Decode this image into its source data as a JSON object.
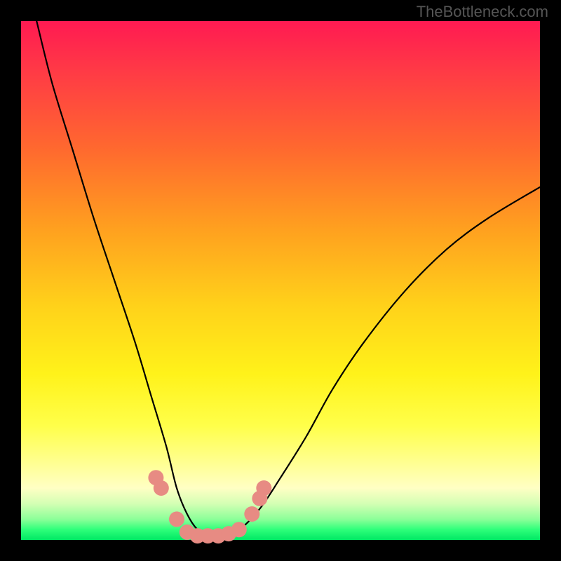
{
  "watermark": "TheBottleneck.com",
  "chart_data": {
    "type": "line",
    "title": "",
    "xlabel": "",
    "ylabel": "",
    "xlim": [
      0,
      100
    ],
    "ylim": [
      0,
      100
    ],
    "gradient_stops": [
      {
        "pos": 0,
        "color": "#ff1a52"
      },
      {
        "pos": 25,
        "color": "#ff6a2e"
      },
      {
        "pos": 55,
        "color": "#ffd21a"
      },
      {
        "pos": 85,
        "color": "#ffff90"
      },
      {
        "pos": 96,
        "color": "#8cff99"
      },
      {
        "pos": 100,
        "color": "#00e864"
      }
    ],
    "series": [
      {
        "name": "bottleneck-curve",
        "x": [
          3,
          6,
          10,
          14,
          18,
          22,
          25,
          28,
          30,
          32,
          34,
          36,
          38,
          42,
          46,
          50,
          55,
          60,
          66,
          74,
          82,
          90,
          100
        ],
        "y": [
          100,
          88,
          75,
          62,
          50,
          38,
          28,
          18,
          10,
          5,
          2,
          1,
          1,
          2,
          6,
          12,
          20,
          29,
          38,
          48,
          56,
          62,
          68
        ]
      }
    ],
    "markers": {
      "name": "highlight-dots",
      "color": "#e78b83",
      "points": [
        {
          "x": 26,
          "y": 12
        },
        {
          "x": 27,
          "y": 10
        },
        {
          "x": 30,
          "y": 4
        },
        {
          "x": 32,
          "y": 1.5
        },
        {
          "x": 34,
          "y": 0.8
        },
        {
          "x": 36,
          "y": 0.8
        },
        {
          "x": 38,
          "y": 0.8
        },
        {
          "x": 40,
          "y": 1.2
        },
        {
          "x": 42,
          "y": 2
        },
        {
          "x": 44.5,
          "y": 5
        },
        {
          "x": 46,
          "y": 8
        },
        {
          "x": 46.8,
          "y": 10
        }
      ]
    }
  }
}
